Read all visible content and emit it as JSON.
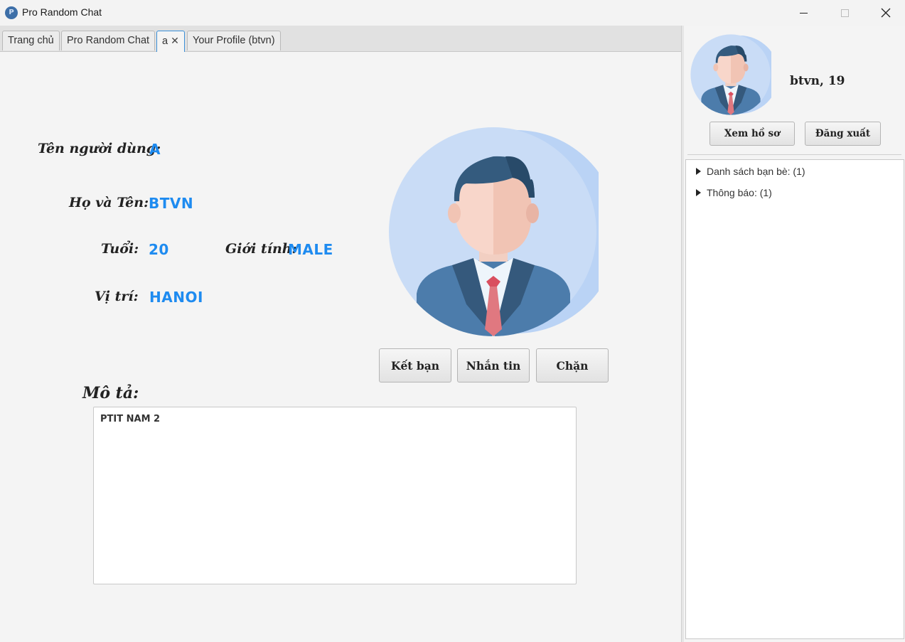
{
  "window": {
    "title": "Pro Random Chat",
    "icon_letter": "P"
  },
  "tabs": [
    {
      "label": "Trang chủ"
    },
    {
      "label": "Pro Random Chat"
    },
    {
      "label": "a",
      "active": true,
      "close": "✕"
    },
    {
      "label": "Your Profile (btvn)"
    }
  ],
  "profile": {
    "username_label": "Tên người dùng:",
    "username_value": "A",
    "fullname_label": "Họ và Tên:",
    "fullname_value": "BTVN",
    "age_label": "Tuổi:",
    "age_value": "20",
    "gender_label": "Giới tính:",
    "gender_value": "MALE",
    "location_label": "Vị trí:",
    "location_value": "HANOI",
    "actions": {
      "add_friend": "Kết bạn",
      "message": "Nhắn tin",
      "block": "Chặn"
    },
    "description_label": "Mô tả:",
    "description_text": "PTIT NAM 2"
  },
  "sidebar": {
    "user_display": "btvn, 19",
    "view_profile": "Xem hồ sơ",
    "logout": "Đăng xuất",
    "tree": [
      {
        "label": "Danh sách bạn bè: (1)"
      },
      {
        "label": "Thông báo: (1)"
      }
    ]
  },
  "colors": {
    "value_accent": "#1e8bf0",
    "tab_active_border": "#3a8fd8"
  }
}
